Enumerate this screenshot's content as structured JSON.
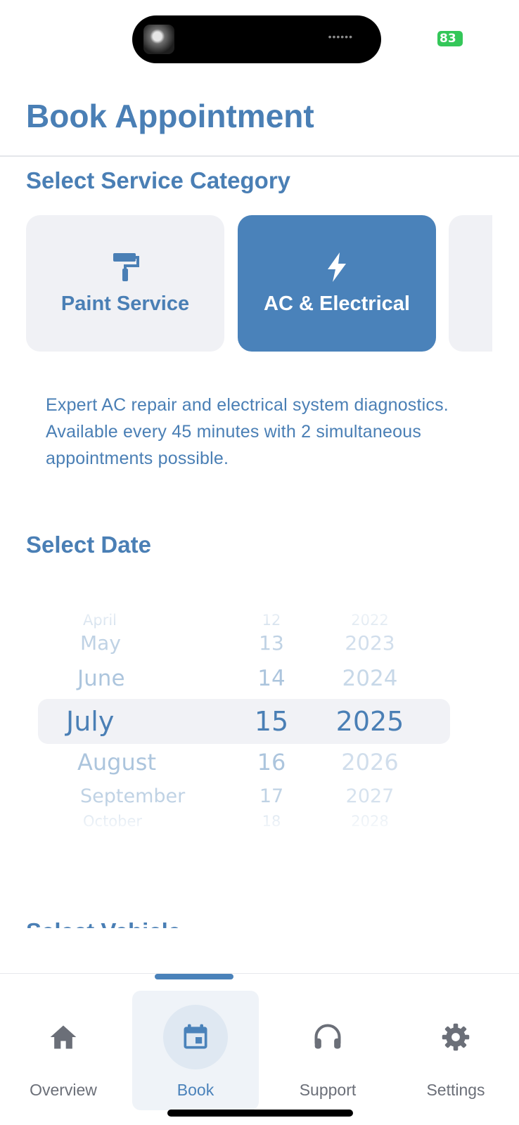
{
  "status": {
    "battery": "83"
  },
  "header": {
    "title": "Book Appointment"
  },
  "service": {
    "section_title": "Select Service Category",
    "categories": [
      {
        "label": "Paint Service",
        "icon": "paint-roller-icon",
        "selected": false
      },
      {
        "label": "AC & Electrical",
        "icon": "lightning-bolt-icon",
        "selected": true
      }
    ],
    "description": "Expert AC repair and electrical system diagnostics. Available every 45 minutes with 2 simultaneous appointments possible."
  },
  "date": {
    "section_title": "Select Date",
    "months": [
      "April",
      "May",
      "June",
      "July",
      "August",
      "September",
      "October"
    ],
    "days": [
      "12",
      "13",
      "14",
      "15",
      "16",
      "17",
      "18"
    ],
    "years": [
      "2022",
      "2023",
      "2024",
      "2025",
      "2026",
      "2027",
      "2028"
    ],
    "selected": {
      "month": "July",
      "day": "15",
      "year": "2025"
    }
  },
  "vehicle": {
    "section_title": "Select Vehicle"
  },
  "tabs": [
    {
      "label": "Overview",
      "icon": "home-icon",
      "active": false
    },
    {
      "label": "Book",
      "icon": "calendar-icon",
      "active": true
    },
    {
      "label": "Support",
      "icon": "headphones-icon",
      "active": false
    },
    {
      "label": "Settings",
      "icon": "gear-icon",
      "active": false
    }
  ],
  "colors": {
    "accent": "#4a82ba",
    "text": "#4a7fb5",
    "card_bg": "#f0f1f5",
    "battery": "#34c759"
  }
}
